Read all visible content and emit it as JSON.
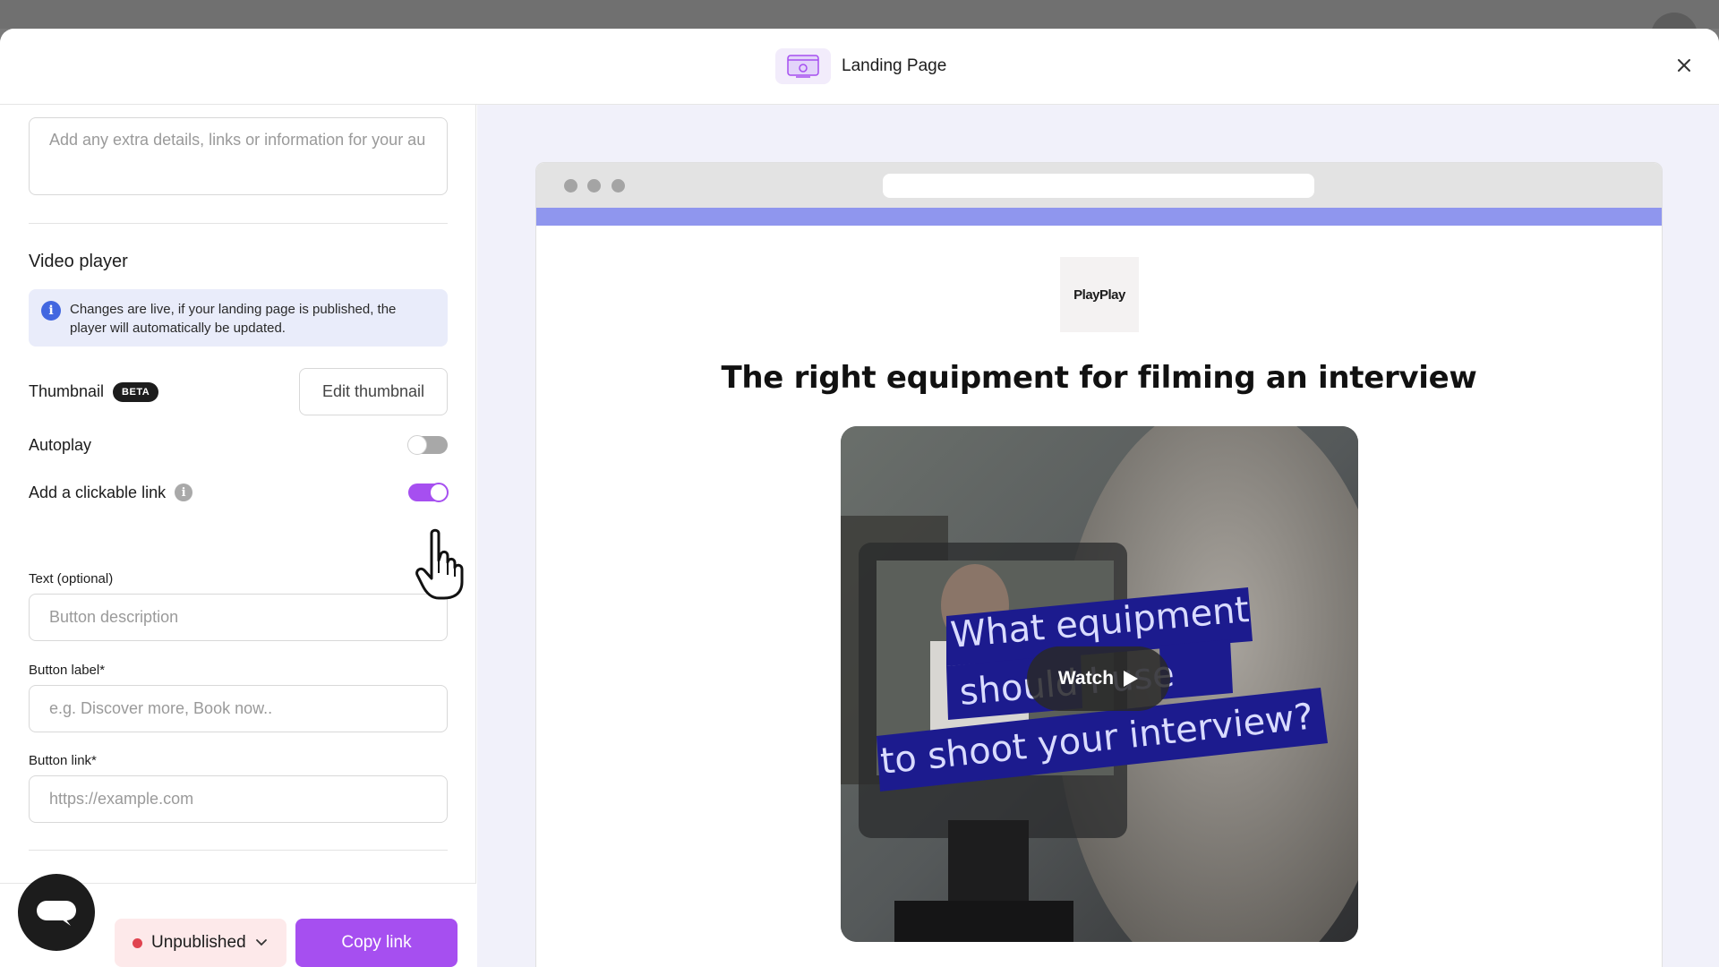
{
  "modal": {
    "title": "Landing Page",
    "header_icon": "landing-page-icon",
    "close_icon": "close-icon"
  },
  "left_panel": {
    "description_placeholder": "Add any extra details, links or information for your au",
    "video_player": {
      "title": "Video player",
      "info_text": "Changes are live, if your landing page is published, the player will automatically be updated.",
      "thumbnail_label": "Thumbnail",
      "beta_badge": "BETA",
      "edit_thumbnail_label": "Edit thumbnail",
      "autoplay_label": "Autoplay",
      "autoplay_on": false,
      "clickable_link_label": "Add a clickable link",
      "clickable_link_on": true,
      "text_label": "Text (optional)",
      "text_placeholder": "Button description",
      "button_label_label": "Button label*",
      "button_label_placeholder": "e.g. Discover more, Book now..",
      "button_link_label": "Button link*",
      "button_link_placeholder": "https://example.com"
    },
    "footer": {
      "status_label": "Unpublished",
      "status_color": "#e04450",
      "copy_link_label": "Copy link"
    }
  },
  "preview": {
    "accent_color": "#8f96ee",
    "logo_text": "PlayPlay",
    "heading": "The right equipment for filming an interview",
    "video_caption_lines": [
      "What equipment",
      "should I use",
      "to shoot your interview?"
    ],
    "watch_label": "Watch"
  },
  "colors": {
    "primary": "#a64ff0",
    "info_bg": "#e9ecfa",
    "preview_bg": "#f1f1fa"
  }
}
